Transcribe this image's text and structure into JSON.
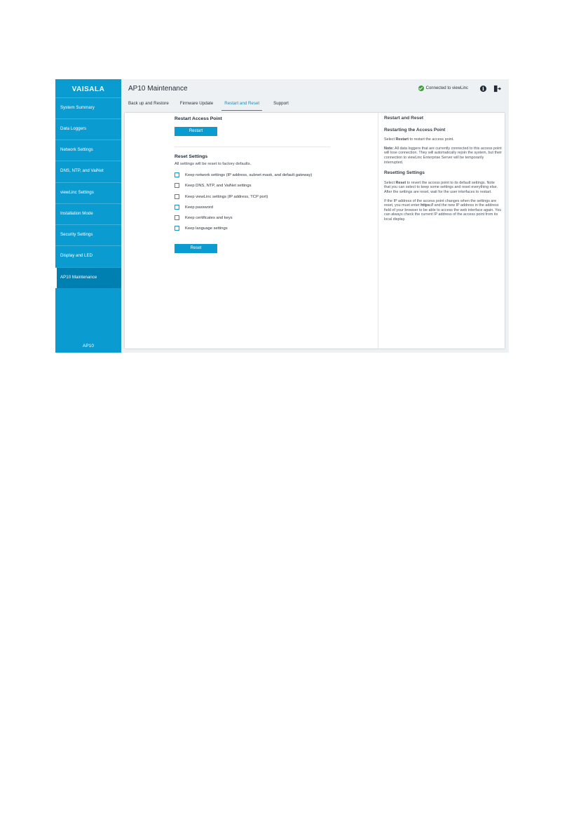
{
  "app": {
    "brand": "VAISALA",
    "title": "AP10 Maintenance",
    "connection_status": "Connected to viewLinc",
    "device_label": "AP10"
  },
  "sidebar": {
    "items": [
      {
        "label": "System Summary",
        "active": false
      },
      {
        "label": "Data Loggers",
        "active": false
      },
      {
        "label": "Network Settings",
        "active": false
      },
      {
        "label": "DNS, NTP, and VaiNet",
        "active": false
      },
      {
        "label": "viewLinc Settings",
        "active": false
      },
      {
        "label": "Installation Mode",
        "active": false
      },
      {
        "label": "Security Settings",
        "active": false
      },
      {
        "label": "Display and LED",
        "active": false
      },
      {
        "label": "AP10 Maintenance",
        "active": true
      }
    ]
  },
  "tabs": [
    {
      "label": "Back up and Restore",
      "active": false
    },
    {
      "label": "Firmware Update",
      "active": false
    },
    {
      "label": "Restart and Reset",
      "active": true
    },
    {
      "label": "Support",
      "active": false
    }
  ],
  "restart": {
    "title": "Restart Access Point",
    "button": "Restart"
  },
  "reset": {
    "title": "Reset Settings",
    "subtitle": "All settings will be reset to factory defaults.",
    "options": [
      "Keep network settings (IP address, subnet mask, and default gateway)",
      "Keep DNS, NTP, and VaiNet settings",
      "Keep viewLinc settings (IP address, TCP port)",
      "Keep password",
      "Keep certificates and keys",
      "Keep language settings"
    ],
    "button": "Reset"
  },
  "help": {
    "title": "Restart and Reset",
    "restart_heading": "Restarting the Access Point",
    "restart_text_pre": "Select ",
    "restart_text_bold": "Restart",
    "restart_text_post": " to restart the access point.",
    "note_bold": "Note:",
    "note_text": " All data loggers that are currently connected to this access point will lose connection. They will automatically rejoin the system, but their connection to viewLinc Enterprise Server will be temporarily interrupted.",
    "reset_heading": "Resetting Settings",
    "reset_text_pre": "Select ",
    "reset_text_bold": "Reset",
    "reset_text_post": " to revert the access point to its default settings. Note that you can select to keep some settings and reset everything else. After the settings are reset, wait for the user interfaces to restart.",
    "ip_text_pre": "If the IP address of the access point changes when the settings are reset, you must enter ",
    "ip_text_bold": "https://",
    "ip_text_post": " and the new IP address in the address field of your browser to be able to access the web interface again. You can always check the current IP address of the access point from its local display."
  },
  "colors": {
    "accent": "#0a9bd1",
    "sidebar_active": "#007fb1",
    "status_ok": "#3aa335"
  }
}
